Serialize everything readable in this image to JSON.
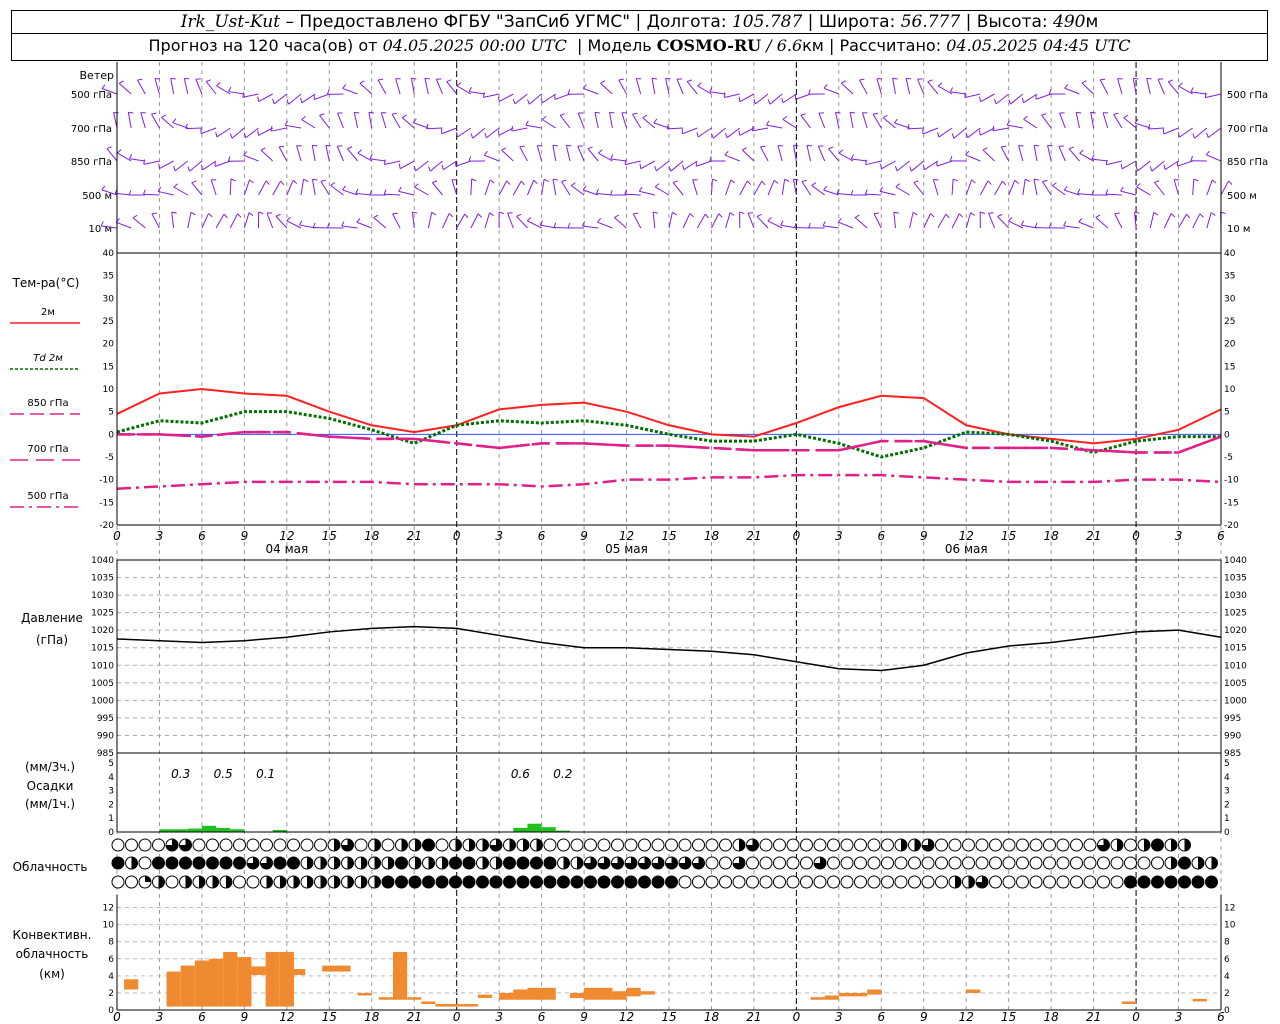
{
  "header": {
    "station": "Irk_Ust-Kut",
    "provider": "– Предоставлено ФГБУ \"ЗапСиб УГМС\"",
    "lon_label": "Долгота:",
    "lon_value": "105.787",
    "lat_label": "Широта:",
    "lat_value": "56.777",
    "alt_label": "Высота:",
    "alt_value": "490",
    "alt_unit": "м",
    "forecast_label": "Прогноз на 120 часа(ов) от",
    "forecast_time": "04.05.2025 00:00 UTC",
    "model_label": "Модель",
    "model_name": "COSMO-RU",
    "model_res": "/ 6.6",
    "model_res_unit": "км",
    "calc_label": "Рассчитано:",
    "calc_time": "04.05.2025 04:45 UTC"
  },
  "wind_panel": {
    "title": "Ветер",
    "levels": [
      "500 гПа",
      "700 гПа",
      "850 гПа",
      "500 м",
      "10 м"
    ]
  },
  "temp_panel": {
    "title": "Тем-ра(°C)",
    "legend": [
      {
        "label": "2м",
        "color": "#ff2020",
        "style": "solid"
      },
      {
        "label": "Td  2м",
        "color": "#007000",
        "style": "dotted"
      },
      {
        "label": "850 гПа",
        "color": "#e0208a",
        "style": "dash"
      },
      {
        "label": "700 гПа",
        "color": "#e0208a",
        "style": "longdash"
      },
      {
        "label": "500 гПа",
        "color": "#e0208a",
        "style": "dashdot"
      }
    ]
  },
  "pressure_panel": {
    "title_line1": "Давление",
    "title_line2": "(гПа)"
  },
  "precip_panel": {
    "title_line1": "(мм/3ч.)",
    "title_line2": "Осадки",
    "title_line3": "(мм/1ч.)"
  },
  "cloud_panel": {
    "title": "Облачность"
  },
  "conv_panel": {
    "title_line1": "Конвективн.",
    "title_line2": "облачность",
    "title_line3": "(км)"
  },
  "x_axis": {
    "tick_labels": [
      "0",
      "3",
      "6",
      "9",
      "12",
      "15",
      "18",
      "21",
      "0",
      "3",
      "6",
      "9",
      "12",
      "15",
      "18",
      "21",
      "0",
      "3",
      "6",
      "9",
      "12",
      "15",
      "18",
      "21",
      "0",
      "3",
      "6"
    ],
    "date_labels": [
      "04 мая",
      "05 мая",
      "06 мая"
    ]
  },
  "chart_data": [
    {
      "type": "line",
      "title": "Тем-ра(°C)",
      "x_hours": [
        0,
        3,
        6,
        9,
        12,
        15,
        18,
        21,
        24,
        27,
        30,
        33,
        36,
        39,
        42,
        45,
        48,
        51,
        54,
        57,
        60,
        63,
        66,
        69,
        72,
        75,
        78
      ],
      "ylim": [
        -20,
        40
      ],
      "y_ticks": [
        -20,
        -15,
        -10,
        -5,
        0,
        5,
        10,
        15,
        20,
        25,
        30,
        35,
        40
      ],
      "series": [
        {
          "name": "2м",
          "values": [
            4.5,
            9,
            10,
            9,
            8.5,
            5,
            2,
            0.5,
            2,
            5.5,
            6.5,
            7,
            5,
            2,
            0,
            -0.5,
            2.5,
            6,
            8.5,
            8,
            2,
            0,
            -1,
            -2,
            -1,
            1,
            5.5
          ]
        },
        {
          "name": "Td  2м",
          "values": [
            0.5,
            3,
            2.5,
            5,
            5,
            3.5,
            1,
            -2,
            2,
            3,
            2.5,
            3,
            2,
            0,
            -1.5,
            -1.5,
            0,
            -2,
            -5,
            -3,
            0.5,
            0,
            -1.5,
            -4,
            -1.5,
            -0.5,
            -0.5
          ]
        },
        {
          "name": "850 гПа",
          "values": [
            0,
            0,
            -0.5,
            0.5,
            0.5,
            -0.5,
            -1,
            -1,
            -2,
            -3,
            -2,
            -2,
            -2.5,
            -2.5,
            -3,
            -3.5,
            -3.5,
            -3.5,
            -1.5,
            -1.5,
            -3,
            -3,
            -3,
            -3.5,
            -4,
            -4,
            -0.5
          ]
        },
        {
          "name": "700 гПа",
          "values": [
            0,
            0,
            -0.5,
            0.5,
            0.5,
            -0.5,
            -1,
            -1,
            -2,
            -3,
            -2,
            -2,
            -2.5,
            -2.5,
            -3,
            -3.5,
            -3.5,
            -3.5,
            -1.5,
            -1.5,
            -3,
            -3,
            -3,
            -3.5,
            -4,
            -4,
            -0.5
          ]
        },
        {
          "name": "500 гПа",
          "values": [
            -12,
            -11.5,
            -11,
            -10.5,
            -10.5,
            -10.5,
            -10.5,
            -11,
            -11,
            -11,
            -11.5,
            -11,
            -10,
            -10,
            -9.5,
            -9.5,
            -9,
            -9,
            -9,
            -9.5,
            -10,
            -10.5,
            -10.5,
            -10.5,
            -10,
            -10,
            -10.5
          ]
        }
      ]
    },
    {
      "type": "line",
      "title": "Давление",
      "ylabel": "(гПа)",
      "x_hours": [
        0,
        3,
        6,
        9,
        12,
        15,
        18,
        21,
        24,
        27,
        30,
        33,
        36,
        39,
        42,
        45,
        48,
        51,
        54,
        57,
        60,
        63,
        66,
        69,
        72,
        75,
        78
      ],
      "ylim": [
        985,
        1040
      ],
      "y_ticks": [
        985,
        990,
        995,
        1000,
        1005,
        1010,
        1015,
        1020,
        1025,
        1030,
        1035,
        1040
      ],
      "series": [
        {
          "name": "Давление",
          "values": [
            1017.5,
            1017,
            1016.5,
            1017,
            1018,
            1019.5,
            1020.5,
            1021,
            1020.5,
            1018.5,
            1016.5,
            1015,
            1015,
            1014.5,
            1014,
            1013,
            1011,
            1009,
            1008.5,
            1010,
            1013.5,
            1015.5,
            1016.5,
            1018,
            1019.5,
            1020,
            1018
          ]
        }
      ]
    },
    {
      "type": "bar",
      "title": "Осадки",
      "ylabel": "(мм/1ч.)",
      "ylim": [
        0,
        5
      ],
      "y_ticks": [
        0,
        1,
        2,
        3,
        4,
        5
      ],
      "x_hours": [
        3,
        4,
        5,
        6,
        7,
        8,
        11,
        28,
        29,
        30,
        31
      ],
      "values": [
        0.2,
        0.2,
        0.25,
        0.45,
        0.3,
        0.2,
        0.15,
        0.3,
        0.6,
        0.35,
        0.1
      ],
      "annotations": [
        {
          "hour": 4.5,
          "text": "0.3"
        },
        {
          "hour": 7.5,
          "text": "0.5"
        },
        {
          "hour": 10.5,
          "text": "0.1"
        },
        {
          "hour": 28.5,
          "text": "0.6"
        },
        {
          "hour": 31.5,
          "text": "0.2"
        }
      ]
    },
    {
      "type": "bar",
      "title": "Конвективн. облачность",
      "ylabel": "(км)",
      "ylim": [
        0,
        13
      ],
      "y_ticks": [
        0,
        2,
        4,
        6,
        8,
        10,
        12
      ],
      "bars": [
        {
          "h0": 0.5,
          "h1": 1.5,
          "bottom": 2.4,
          "top": 3.6
        },
        {
          "h0": 3.5,
          "h1": 4.5,
          "bottom": 0.4,
          "top": 4.5
        },
        {
          "h0": 4.5,
          "h1": 5.5,
          "bottom": 0.4,
          "top": 5.2
        },
        {
          "h0": 5.5,
          "h1": 6.5,
          "bottom": 0.4,
          "top": 5.8
        },
        {
          "h0": 6.5,
          "h1": 7.5,
          "bottom": 0.4,
          "top": 6
        },
        {
          "h0": 7.5,
          "h1": 8.5,
          "bottom": 0.4,
          "top": 6.8
        },
        {
          "h0": 8.5,
          "h1": 9.5,
          "bottom": 0.4,
          "top": 6.2
        },
        {
          "h0": 9.5,
          "h1": 10.5,
          "bottom": 4.1,
          "top": 5.1
        },
        {
          "h0": 10.5,
          "h1": 11.5,
          "bottom": 0.4,
          "top": 6.8
        },
        {
          "h0": 11.5,
          "h1": 12.5,
          "bottom": 0.4,
          "top": 6.8
        },
        {
          "h0": 12.5,
          "h1": 13.3,
          "bottom": 4.1,
          "top": 4.8
        },
        {
          "h0": 14.5,
          "h1": 16.5,
          "bottom": 4.5,
          "top": 5.2
        },
        {
          "h0": 17,
          "h1": 18,
          "bottom": 1.7,
          "top": 2
        },
        {
          "h0": 18.5,
          "h1": 19.5,
          "bottom": 1.2,
          "top": 1.5
        },
        {
          "h0": 19.5,
          "h1": 20.5,
          "bottom": 1.2,
          "top": 6.8
        },
        {
          "h0": 20.5,
          "h1": 21.5,
          "bottom": 1.2,
          "top": 1.5
        },
        {
          "h0": 21.5,
          "h1": 22.5,
          "bottom": 0.7,
          "top": 1
        },
        {
          "h0": 22.5,
          "h1": 24.5,
          "bottom": 0.4,
          "top": 0.7
        },
        {
          "h0": 24.5,
          "h1": 25.5,
          "bottom": 0.4,
          "top": 0.7
        },
        {
          "h0": 25.5,
          "h1": 26.5,
          "bottom": 1.4,
          "top": 1.8
        },
        {
          "h0": 27,
          "h1": 28,
          "bottom": 1.2,
          "top": 2
        },
        {
          "h0": 28,
          "h1": 29,
          "bottom": 1.2,
          "top": 2.4
        },
        {
          "h0": 29,
          "h1": 31,
          "bottom": 1.2,
          "top": 2.6
        },
        {
          "h0": 32,
          "h1": 33,
          "bottom": 1.4,
          "top": 2
        },
        {
          "h0": 33,
          "h1": 35,
          "bottom": 1.2,
          "top": 2.6
        },
        {
          "h0": 35,
          "h1": 36,
          "bottom": 1.2,
          "top": 2.2
        },
        {
          "h0": 36,
          "h1": 37,
          "bottom": 1.6,
          "top": 2.6
        },
        {
          "h0": 37,
          "h1": 38,
          "bottom": 1.8,
          "top": 2.2
        },
        {
          "h0": 49,
          "h1": 50,
          "bottom": 1.2,
          "top": 1.5
        },
        {
          "h0": 50,
          "h1": 51,
          "bottom": 1.2,
          "top": 1.7
        },
        {
          "h0": 51,
          "h1": 53,
          "bottom": 1.6,
          "top": 2
        },
        {
          "h0": 53,
          "h1": 54,
          "bottom": 1.8,
          "top": 2.4
        },
        {
          "h0": 60,
          "h1": 61,
          "bottom": 2,
          "top": 2.4
        },
        {
          "h0": 71,
          "h1": 72,
          "bottom": 0.7,
          "top": 1
        },
        {
          "h0": 76,
          "h1": 77,
          "bottom": 1,
          "top": 1.3
        }
      ]
    }
  ],
  "cloud_cover": {
    "row_upper": "eeeetteeeeeeeeeehtehehhfehhhthhheeeeeeeeeeeeeehteeeeeeeeeehhteeeeeeeeeeeethehfhh",
    "row_middle": "fhefffffffttffhhhhhhhfhhhffhhffffhhttttttttteeteeeeeteeeeeeeeeeeeeeeeeeeeeeeeehfhh",
    "row_lower": "eeqhehhhheehhhhhhhhhffffffffffffffffffffffeeeeeeeeeeeeeeeeeeeehhteeeeeeeeeeffffffff"
  },
  "colors": {
    "wind_barb": "#8020e0",
    "grid": "#999999",
    "precip": "#20c020",
    "convective": "#f08a30"
  }
}
